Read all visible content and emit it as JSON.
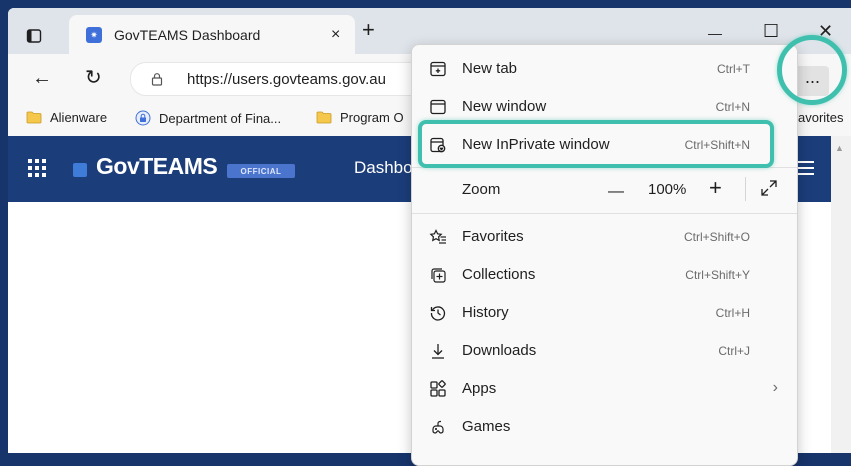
{
  "tab": {
    "title": "GovTEAMS Dashboard",
    "close": "×",
    "new_tab": "+"
  },
  "window_controls": {
    "minimize": "—",
    "maximize": "☐",
    "close": "✕"
  },
  "toolbar": {
    "url": "https://users.govteams.gov.au",
    "more": "···"
  },
  "bookmarks": [
    {
      "label": "Alienware",
      "icon": "folder-icon"
    },
    {
      "label": "Department of Fina...",
      "icon": "lock-badge-icon"
    },
    {
      "label": "Program O",
      "icon": "folder-icon"
    },
    {
      "label": "avorites",
      "icon": "none"
    }
  ],
  "page": {
    "brand": "GovTEAMS",
    "badge": "OFFICIAL",
    "nav": "Dashbo"
  },
  "menu": {
    "items": [
      {
        "label": "New tab",
        "shortcut": "Ctrl+T",
        "icon": "new-tab-icon"
      },
      {
        "label": "New window",
        "shortcut": "Ctrl+N",
        "icon": "new-window-icon"
      },
      {
        "label": "New InPrivate window",
        "shortcut": "Ctrl+Shift+N",
        "icon": "inprivate-icon"
      },
      {
        "label": "Zoom",
        "value": "100%",
        "minus": "—",
        "plus": "+"
      },
      {
        "label": "Favorites",
        "shortcut": "Ctrl+Shift+O",
        "icon": "favorites-icon"
      },
      {
        "label": "Collections",
        "shortcut": "Ctrl+Shift+Y",
        "icon": "collections-icon"
      },
      {
        "label": "History",
        "shortcut": "Ctrl+H",
        "icon": "history-icon"
      },
      {
        "label": "Downloads",
        "shortcut": "Ctrl+J",
        "icon": "download-icon"
      },
      {
        "label": "Apps",
        "chevron": "›",
        "icon": "apps-icon"
      },
      {
        "label": "Games",
        "icon": "games-icon"
      }
    ]
  },
  "colors": {
    "page_bg": "#17346b",
    "header_bg": "#1b3d7a",
    "highlight": "#3fbfad"
  }
}
